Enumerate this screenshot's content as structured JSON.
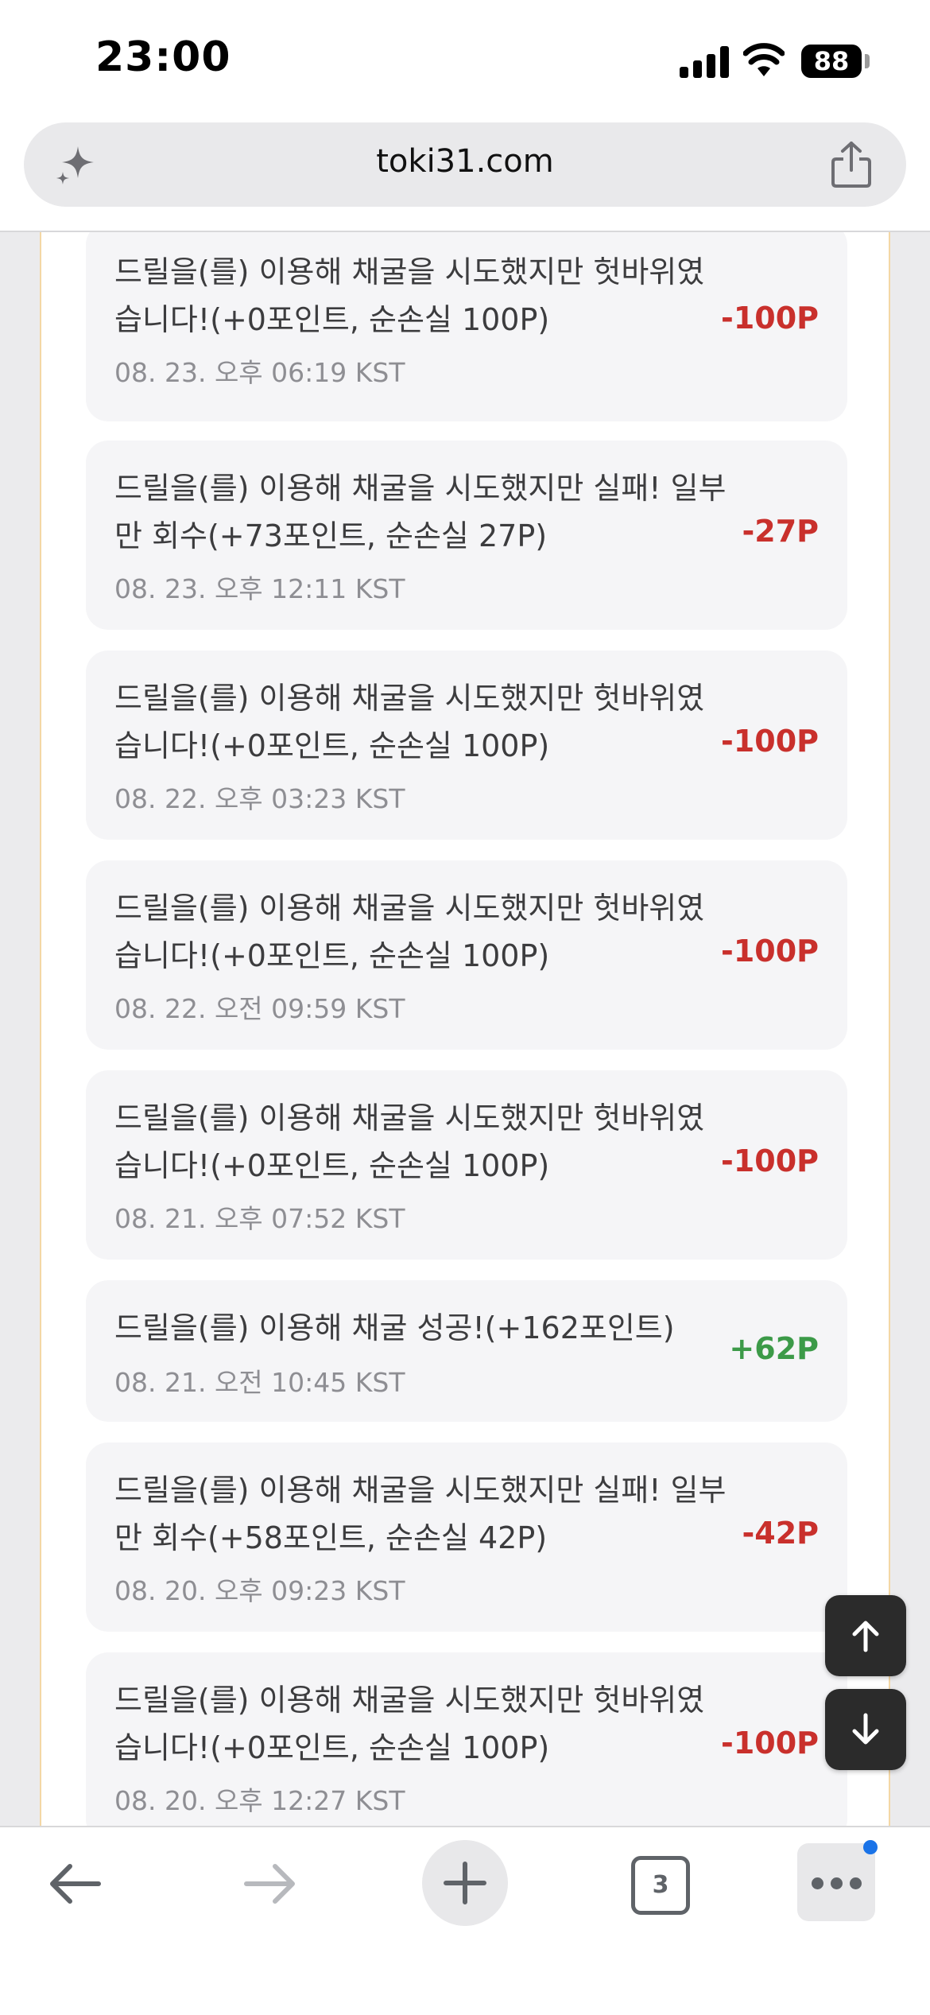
{
  "status_bar": {
    "time": "23:00",
    "battery": "88"
  },
  "browser": {
    "url": "toki31.com",
    "tab_count": "3"
  },
  "history": [
    {
      "message": "드릴을(를) 이용해 채굴을 시도했지만 헛바위였습니다!(+0포인트, 순손실 100P)",
      "date": "08. 23. 오후 06:19 KST",
      "amount": "-100P",
      "type": "loss"
    },
    {
      "message": "드릴을(를) 이용해 채굴을 시도했지만 실패! 일부만 회수(+73포인트, 순손실 27P)",
      "date": "08. 23. 오후 12:11 KST",
      "amount": "-27P",
      "type": "loss"
    },
    {
      "message": "드릴을(를) 이용해 채굴을 시도했지만 헛바위였습니다!(+0포인트, 순손실 100P)",
      "date": "08. 22. 오후 03:23 KST",
      "amount": "-100P",
      "type": "loss"
    },
    {
      "message": "드릴을(를) 이용해 채굴을 시도했지만 헛바위였습니다!(+0포인트, 순손실 100P)",
      "date": "08. 22. 오전 09:59 KST",
      "amount": "-100P",
      "type": "loss"
    },
    {
      "message": "드릴을(를) 이용해 채굴을 시도했지만 헛바위였습니다!(+0포인트, 순손실 100P)",
      "date": "08. 21. 오후 07:52 KST",
      "amount": "-100P",
      "type": "loss"
    },
    {
      "message": "드릴을(를) 이용해 채굴 성공!(+162포인트)",
      "date": "08. 21. 오전 10:45 KST",
      "amount": "+62P",
      "type": "gain"
    },
    {
      "message": "드릴을(를) 이용해 채굴을 시도했지만 실패! 일부만 회수(+58포인트, 순손실 42P)",
      "date": "08. 20. 오후 09:23 KST",
      "amount": "-42P",
      "type": "loss"
    },
    {
      "message": "드릴을(를) 이용해 채굴을 시도했지만 헛바위였습니다!(+0포인트, 순손실 100P)",
      "date": "08. 20. 오후 12:27 KST",
      "amount": "-100P",
      "type": "loss"
    }
  ],
  "icons": {
    "address_bar": [
      "sparkle-icon",
      "share-icon"
    ],
    "scroll": [
      "arrow-up-icon",
      "arrow-down-icon"
    ],
    "bottom_bar": [
      "back-arrow-icon",
      "forward-arrow-icon",
      "plus-icon",
      "tab-count",
      "more-dots-icon"
    ]
  },
  "colors": {
    "loss": "#c9302c",
    "gain": "#3c9a48",
    "panel_border": "#f3d7a5",
    "notification": "#1a73e8"
  }
}
